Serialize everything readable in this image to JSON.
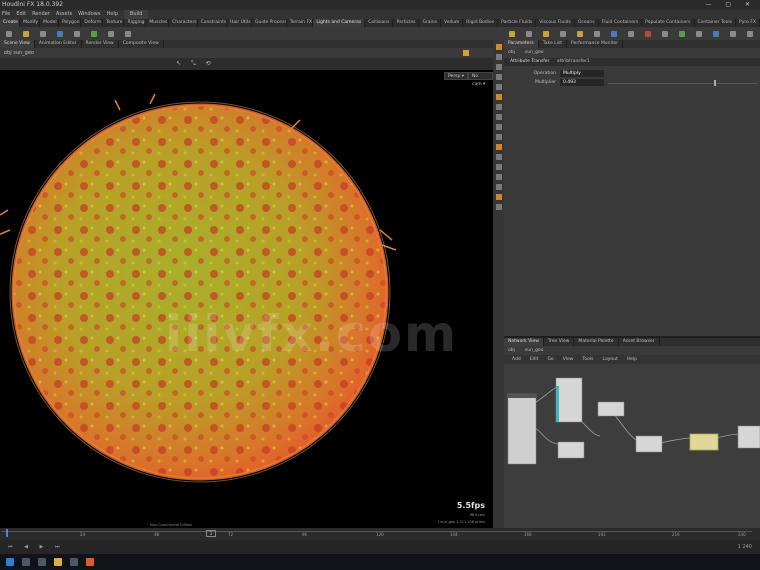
{
  "window": {
    "title": "Houdini FX 18.0.392",
    "controls": "— ▢ ✕"
  },
  "menubar": {
    "items": [
      "File",
      "Edit",
      "Render",
      "Assets",
      "Windows",
      "Help"
    ],
    "desktop_label": "Build"
  },
  "shelf_tabs": {
    "left": [
      "Create",
      "Modify",
      "Model",
      "Polygon",
      "Deform",
      "Texture",
      "Rigging",
      "Muscles",
      "Characters",
      "Constraints",
      "Hair Utils",
      "Guide Process",
      "Terrain FX"
    ],
    "right": [
      "Lights and Cameras",
      "Collisions",
      "Particles",
      "Grains",
      "Vellum",
      "Rigid Bodies",
      "Particle Fluids",
      "Viscous Fluids",
      "Oceans",
      "Fluid Containers",
      "Populate Containers",
      "Container Tools",
      "Pyro FX"
    ]
  },
  "viewport": {
    "tabs": [
      "Scene View",
      "Animation Editor",
      "Render View",
      "Composite View"
    ],
    "path": "obj   sun_geo",
    "cam_persp": "Persp ▾",
    "cam_nocam": "No cam ▾",
    "nav_icons": "↖ ⤡ ⟲",
    "fps": "5.5fps",
    "fps_detail1": "96.52ms",
    "fps_detail2": "1 sun_geo  1,311,208 prims",
    "stats": "Non-Commercial Edition"
  },
  "params": {
    "tabs": [
      "Parameters",
      "Take List",
      "Performance Monitor"
    ],
    "path_items": [
      "obj",
      "sun_geo"
    ],
    "node_type": "Attribute Transfer",
    "node_name": "attribtransfer1",
    "rows": [
      {
        "label": "Operation",
        "value": "Multiply"
      },
      {
        "label": "Multiplier",
        "value": "0.493"
      }
    ]
  },
  "network": {
    "tabs": [
      "Network View",
      "Tree View",
      "Material Palette",
      "Asset Browser"
    ],
    "path_items": [
      "obj",
      "sun_geo"
    ],
    "menu": [
      "Add",
      "Edit",
      "Go",
      "View",
      "Tools",
      "Layout",
      "Help"
    ]
  },
  "timeline": {
    "ticks": [
      "1",
      "24",
      "48",
      "72",
      "96",
      "120",
      "144",
      "168",
      "192",
      "216",
      "240"
    ],
    "frame": "1",
    "play_controls": "⏮ ◀ ▶ ⏭",
    "range": "1   240"
  }
}
